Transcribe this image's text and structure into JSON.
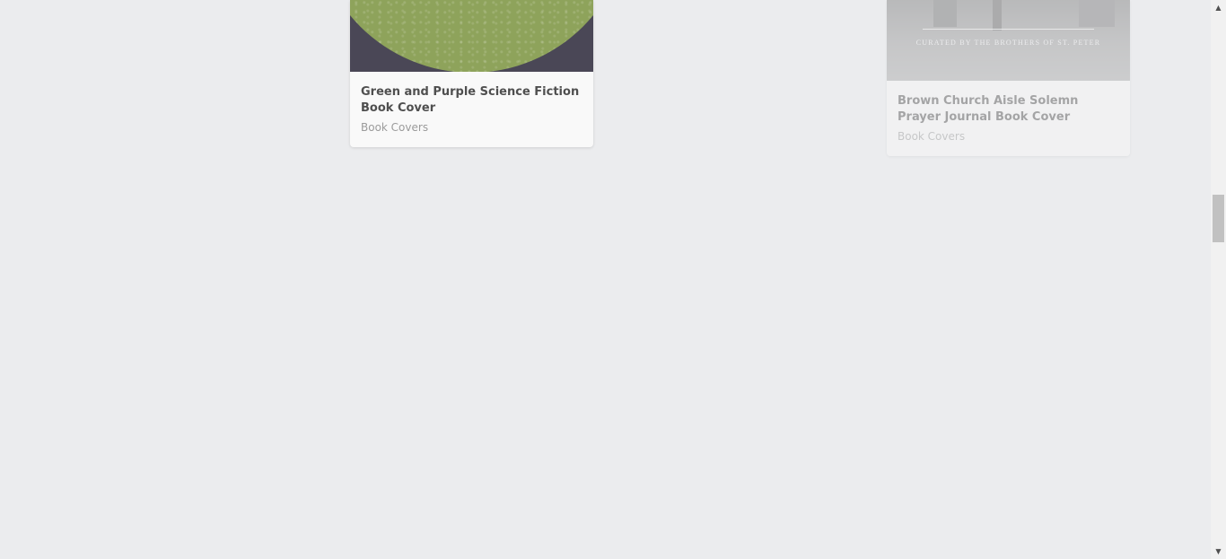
{
  "cards": [
    {
      "title": "Green and Purple Science Fiction Book Cover",
      "category": "Book Covers"
    },
    {
      "title": "Brown Church Aisle Solemn Prayer Journal Book Cover",
      "category": "Book Covers",
      "cover_text": "CURATED BY THE BROTHERS OF ST. PETER"
    }
  ],
  "scrollbar": {
    "up_icon": "▲",
    "down_icon": "▼"
  },
  "colors": {
    "background": "#ebecee",
    "card": "#f9f9f9",
    "title": "#4f4f4f",
    "category": "#9b9b9b"
  }
}
